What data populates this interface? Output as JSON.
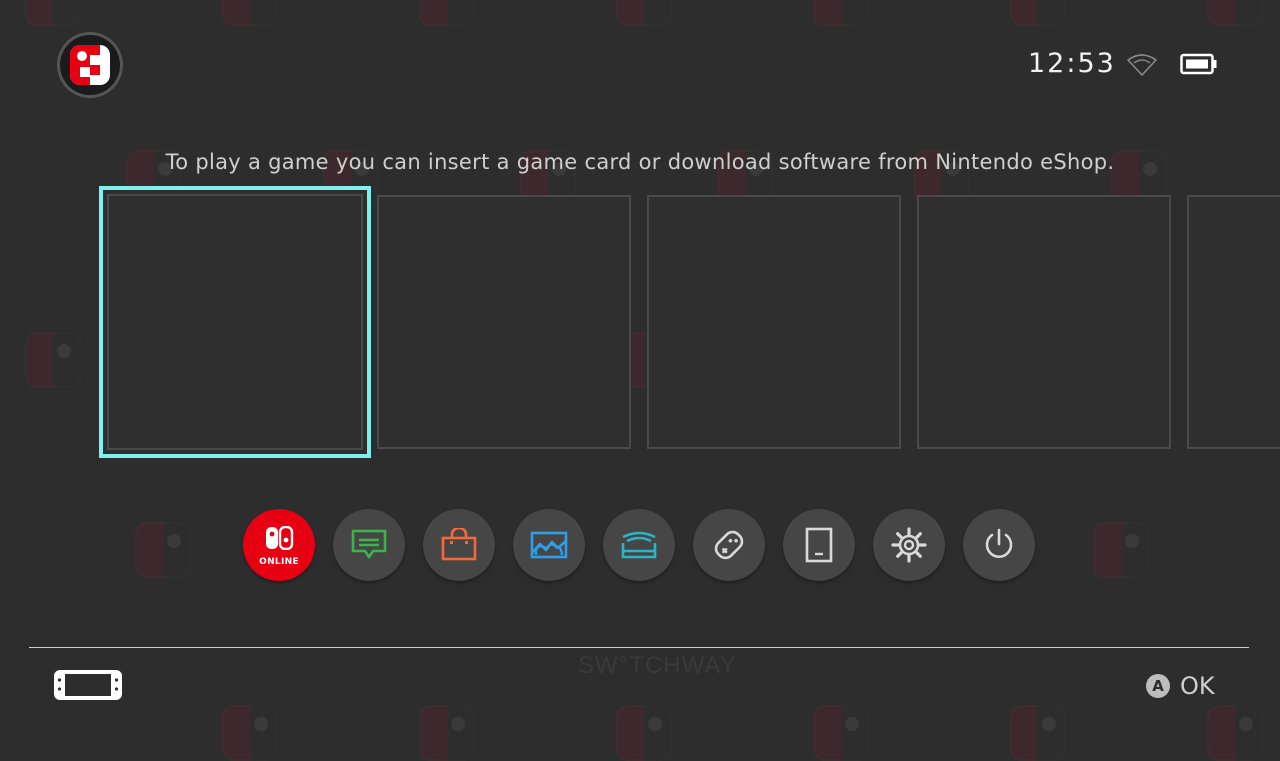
{
  "header": {
    "time": "12:53",
    "user_icon": "mii-user-icon",
    "wifi_icon": "wifi-icon",
    "battery_icon": "battery-icon"
  },
  "main": {
    "hint": "To play a game you can insert a game card or download software from Nintendo eShop.",
    "tiles": [
      "",
      "",
      "",
      "",
      ""
    ]
  },
  "dock": {
    "items": [
      {
        "name": "Nintendo Switch Online",
        "label": "ONLINE",
        "icon": "switch-online-icon",
        "color": "#e60012"
      },
      {
        "name": "News",
        "icon": "news-icon",
        "color": "#3bb54a"
      },
      {
        "name": "Nintendo eShop",
        "icon": "shop-bag-icon",
        "color": "#f26a3c"
      },
      {
        "name": "Album",
        "icon": "album-icon",
        "color": "#2f9ee8"
      },
      {
        "name": "Controllers",
        "icon": "controller-icon",
        "color": "#2bb5c4"
      },
      {
        "name": "Controllers Settings",
        "icon": "joycon-icon",
        "color": "#d9d9d9"
      },
      {
        "name": "Sleep",
        "icon": "tablet-icon",
        "color": "#d9d9d9"
      },
      {
        "name": "System Settings",
        "icon": "gear-icon",
        "color": "#d9d9d9"
      },
      {
        "name": "Power",
        "icon": "power-icon",
        "color": "#d9d9d9"
      }
    ]
  },
  "footer": {
    "watermark": "SW°TCHWAY",
    "a_button": "A",
    "ok_label": "OK"
  },
  "colors": {
    "background": "#2d2d2d",
    "selection": "#7ff0f0",
    "accent_red": "#e60012"
  }
}
